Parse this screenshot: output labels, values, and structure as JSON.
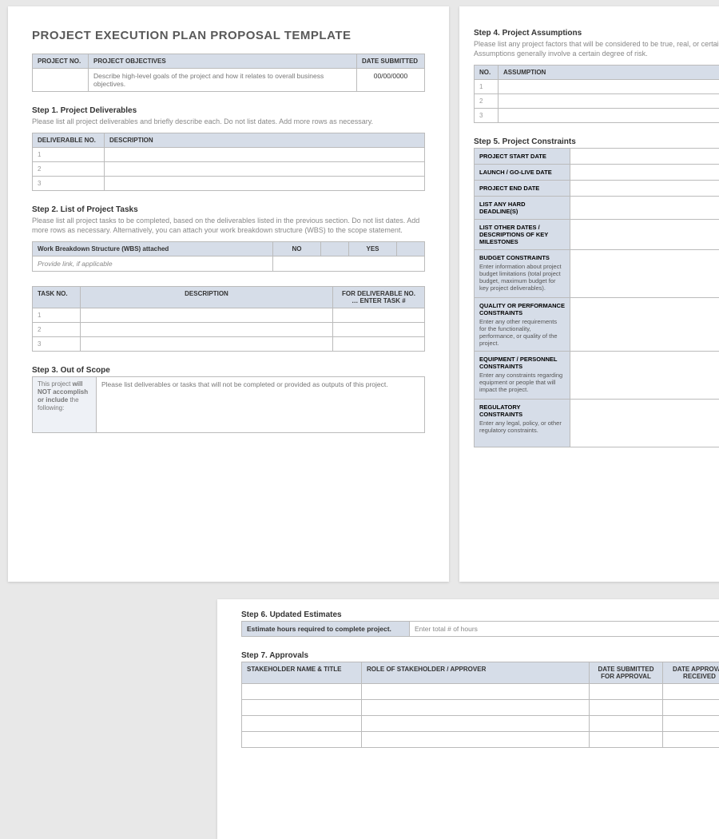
{
  "title": "PROJECT EXECUTION PLAN PROPOSAL TEMPLATE",
  "topTable": {
    "headers": [
      "PROJECT NO.",
      "PROJECT OBJECTIVES",
      "DATE SUBMITTED"
    ],
    "objectives": "Describe high-level goals of the project and how it relates to overall business objectives.",
    "date": "00/00/0000"
  },
  "step1": {
    "title": "Step 1. Project Deliverables",
    "desc": "Please list all project deliverables and briefly describe each. Do not list dates. Add more rows as necessary.",
    "headers": [
      "DELIVERABLE NO.",
      "DESCRIPTION"
    ],
    "rows": [
      "1",
      "2",
      "3"
    ]
  },
  "step2": {
    "title": "Step 2. List of Project Tasks",
    "desc": "Please list all project tasks to be completed, based on the deliverables listed in the previous section. Do not list dates. Add more rows as necessary. Alternatively, you can attach your work breakdown structure (WBS) to the scope statement.",
    "wbs": {
      "label": "Work Breakdown Structure (WBS) attached",
      "no": "NO",
      "yes": "YES",
      "link": "Provide link, if applicable"
    },
    "taskHeaders": [
      "TASK NO.",
      "DESCRIPTION",
      "FOR DELIVERABLE NO. … ENTER TASK #"
    ],
    "rows": [
      "1",
      "2",
      "3"
    ]
  },
  "step3": {
    "title": "Step 3. Out of Scope",
    "labelPrefix": "This project ",
    "labelBold": "will NOT accomplish or include",
    "labelSuffix": " the following:",
    "body": "Please list deliverables or tasks that will not be completed or provided as outputs of this project."
  },
  "step4": {
    "title": "Step 4. Project Assumptions",
    "desc": "Please list any project factors that will be considered to be true, real, or certain. Assumptions generally involve a certain degree of risk.",
    "headers": [
      "NO.",
      "ASSUMPTION"
    ],
    "rows": [
      "1",
      "2",
      "3"
    ]
  },
  "step5": {
    "title": "Step 5. Project Constraints",
    "rows": [
      {
        "label": "PROJECT START DATE",
        "sub": ""
      },
      {
        "label": "LAUNCH / GO-LIVE DATE",
        "sub": ""
      },
      {
        "label": "PROJECT END DATE",
        "sub": ""
      },
      {
        "label": "LIST ANY HARD DEADLINE(S)",
        "sub": ""
      },
      {
        "label": "LIST OTHER DATES / DESCRIPTIONS OF KEY MILESTONES",
        "sub": ""
      },
      {
        "label": "BUDGET CONSTRAINTS",
        "sub": "Enter information about project budget limitations (total project budget, maximum budget for key project deliverables)."
      },
      {
        "label": "QUALITY OR PERFORMANCE CONSTRAINTS",
        "sub": "Enter any other requirements for the functionality, performance, or quality of the project."
      },
      {
        "label": "EQUIPMENT / PERSONNEL CONSTRAINTS",
        "sub": "Enter any constraints regarding equipment or people that will impact the project."
      },
      {
        "label": "REGULATORY CONSTRAINTS",
        "sub": "Enter any legal, policy, or other regulatory constraints."
      }
    ]
  },
  "step6": {
    "title": "Step 6. Updated Estimates",
    "label": "Estimate hours required to complete project.",
    "placeholder": "Enter total # of hours"
  },
  "step7": {
    "title": "Step 7. Approvals",
    "headers": [
      "STAKEHOLDER NAME & TITLE",
      "ROLE OF STAKEHOLDER / APPROVER",
      "DATE SUBMITTED FOR APPROVAL",
      "DATE APPROVAL RECEIVED"
    ]
  }
}
